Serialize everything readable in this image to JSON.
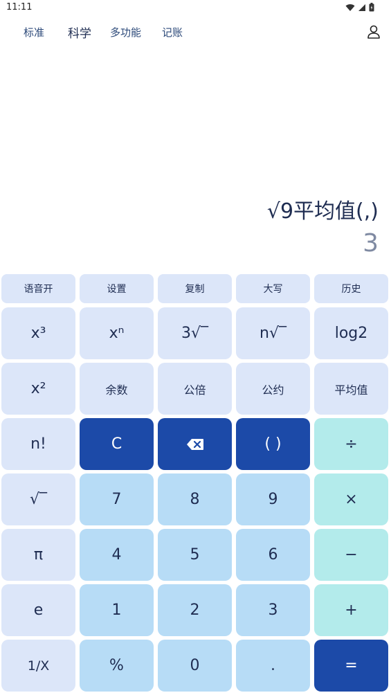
{
  "status": {
    "time": "11:11"
  },
  "tabs": [
    {
      "label": "标准"
    },
    {
      "label": "科学"
    },
    {
      "label": "多功能"
    },
    {
      "label": "记账"
    }
  ],
  "display": {
    "expression": "√9平均值(,)",
    "result": "3"
  },
  "top_row": [
    "语音开",
    "设置",
    "复制",
    "大写",
    "历史"
  ],
  "keys": {
    "r1": [
      "x³",
      "xⁿ",
      "3√‾",
      "n√‾",
      "log2"
    ],
    "r2": [
      "x²",
      "余数",
      "公倍",
      "公约",
      "平均值"
    ],
    "r3": [
      "n!",
      "C",
      "⌫",
      "( )",
      "÷"
    ],
    "r4": [
      "√‾",
      "7",
      "8",
      "9",
      "×"
    ],
    "r5": [
      "π",
      "4",
      "5",
      "6",
      "−"
    ],
    "r6": [
      "e",
      "1",
      "2",
      "3",
      "+"
    ],
    "r7": [
      "1/X",
      "%",
      "0",
      ".",
      "="
    ]
  },
  "colors": {
    "func": "#dce6f9",
    "num": "#b7dcf6",
    "op": "#b3ebeb",
    "dark": "#1c4aa8"
  }
}
